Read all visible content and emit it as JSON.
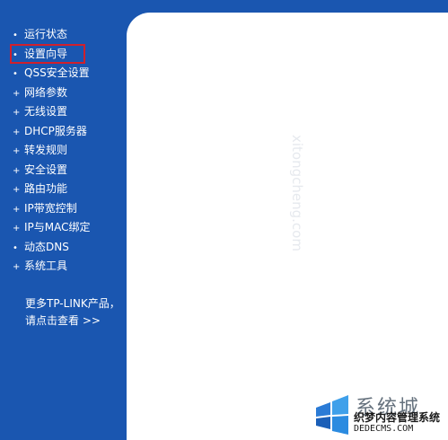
{
  "sidebar": {
    "items": [
      {
        "label": "运行状态",
        "bullet": "•"
      },
      {
        "label": "设置向导",
        "bullet": "•"
      },
      {
        "label": "QSS安全设置",
        "bullet": "•"
      },
      {
        "label": "网络参数",
        "bullet": "+"
      },
      {
        "label": "无线设置",
        "bullet": "+"
      },
      {
        "label": "DHCP服务器",
        "bullet": "+"
      },
      {
        "label": "转发规则",
        "bullet": "+"
      },
      {
        "label": "安全设置",
        "bullet": "+"
      },
      {
        "label": "路由功能",
        "bullet": "+"
      },
      {
        "label": "IP带宽控制",
        "bullet": "+"
      },
      {
        "label": "IP与MAC绑定",
        "bullet": "+"
      },
      {
        "label": "动态DNS",
        "bullet": "•"
      },
      {
        "label": "系统工具",
        "bullet": "+"
      }
    ],
    "more_link": {
      "line1": "更多TP-LINK产品，",
      "line2": "请点击查看 >>"
    }
  },
  "watermark": {
    "faint_text": "xitongcheng.com",
    "big_text": "系统城",
    "cn_text": "织梦内容管理系统",
    "url_text": "DEDECMS.COM"
  },
  "colors": {
    "sidebar_bg": "#1a56b0",
    "highlight": "#d0202c",
    "content_bg": "#ffffff"
  }
}
